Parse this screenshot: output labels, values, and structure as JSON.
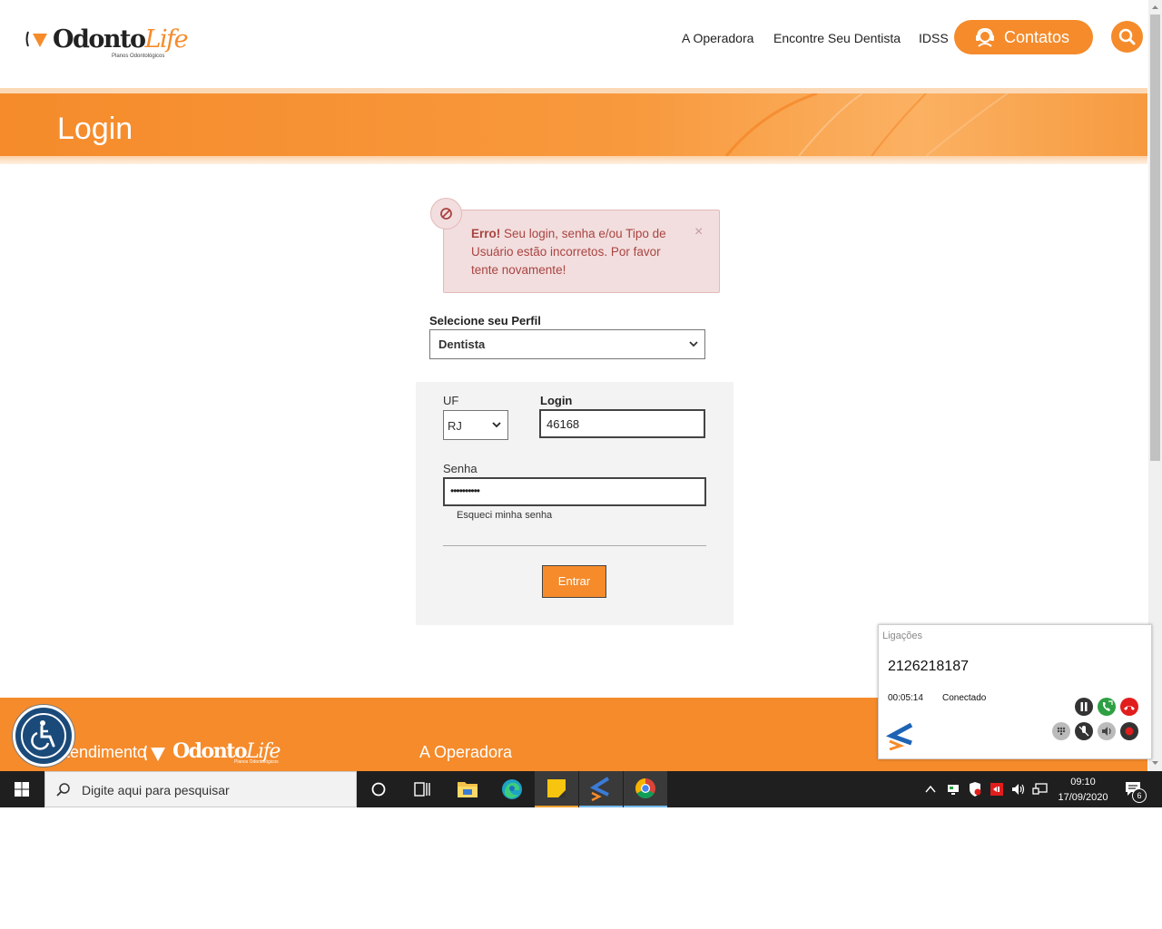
{
  "header": {
    "logo_text_1": "Odonto",
    "logo_text_2": "Life",
    "logo_sub": "Planos Odontológicos",
    "nav": [
      "A Operadora",
      "Encontre Seu Dentista",
      "IDSS"
    ],
    "contatos_label": "Contatos"
  },
  "banner": {
    "title": "Login"
  },
  "alert": {
    "prefix": "Erro!",
    "message": " Seu login, senha e/ou Tipo de Usuário estão incorretos. Por favor tente novamente!",
    "close": "×"
  },
  "form": {
    "perfil_label": "Selecione seu Perfil",
    "perfil_value": "Dentista",
    "uf_label": "UF",
    "uf_value": "RJ",
    "login_label": "Login",
    "login_value": "46168",
    "senha_label": "Senha",
    "senha_value": "••••••••••",
    "forgot": "Esqueci minha senha",
    "submit": "Entrar"
  },
  "footer": {
    "atendimento": "Atendimento",
    "operadora": "A Operadora"
  },
  "call": {
    "title": "Ligações",
    "number": "2126218187",
    "duration": "00:05:14",
    "status": "Conectado"
  },
  "taskbar": {
    "search_placeholder": "Digite aqui para pesquisar",
    "time": "09:10",
    "date": "17/09/2020",
    "notifications": "6"
  },
  "colors": {
    "accent": "#f58b2b",
    "error_bg": "#f2dede",
    "error_text": "#a94442"
  }
}
